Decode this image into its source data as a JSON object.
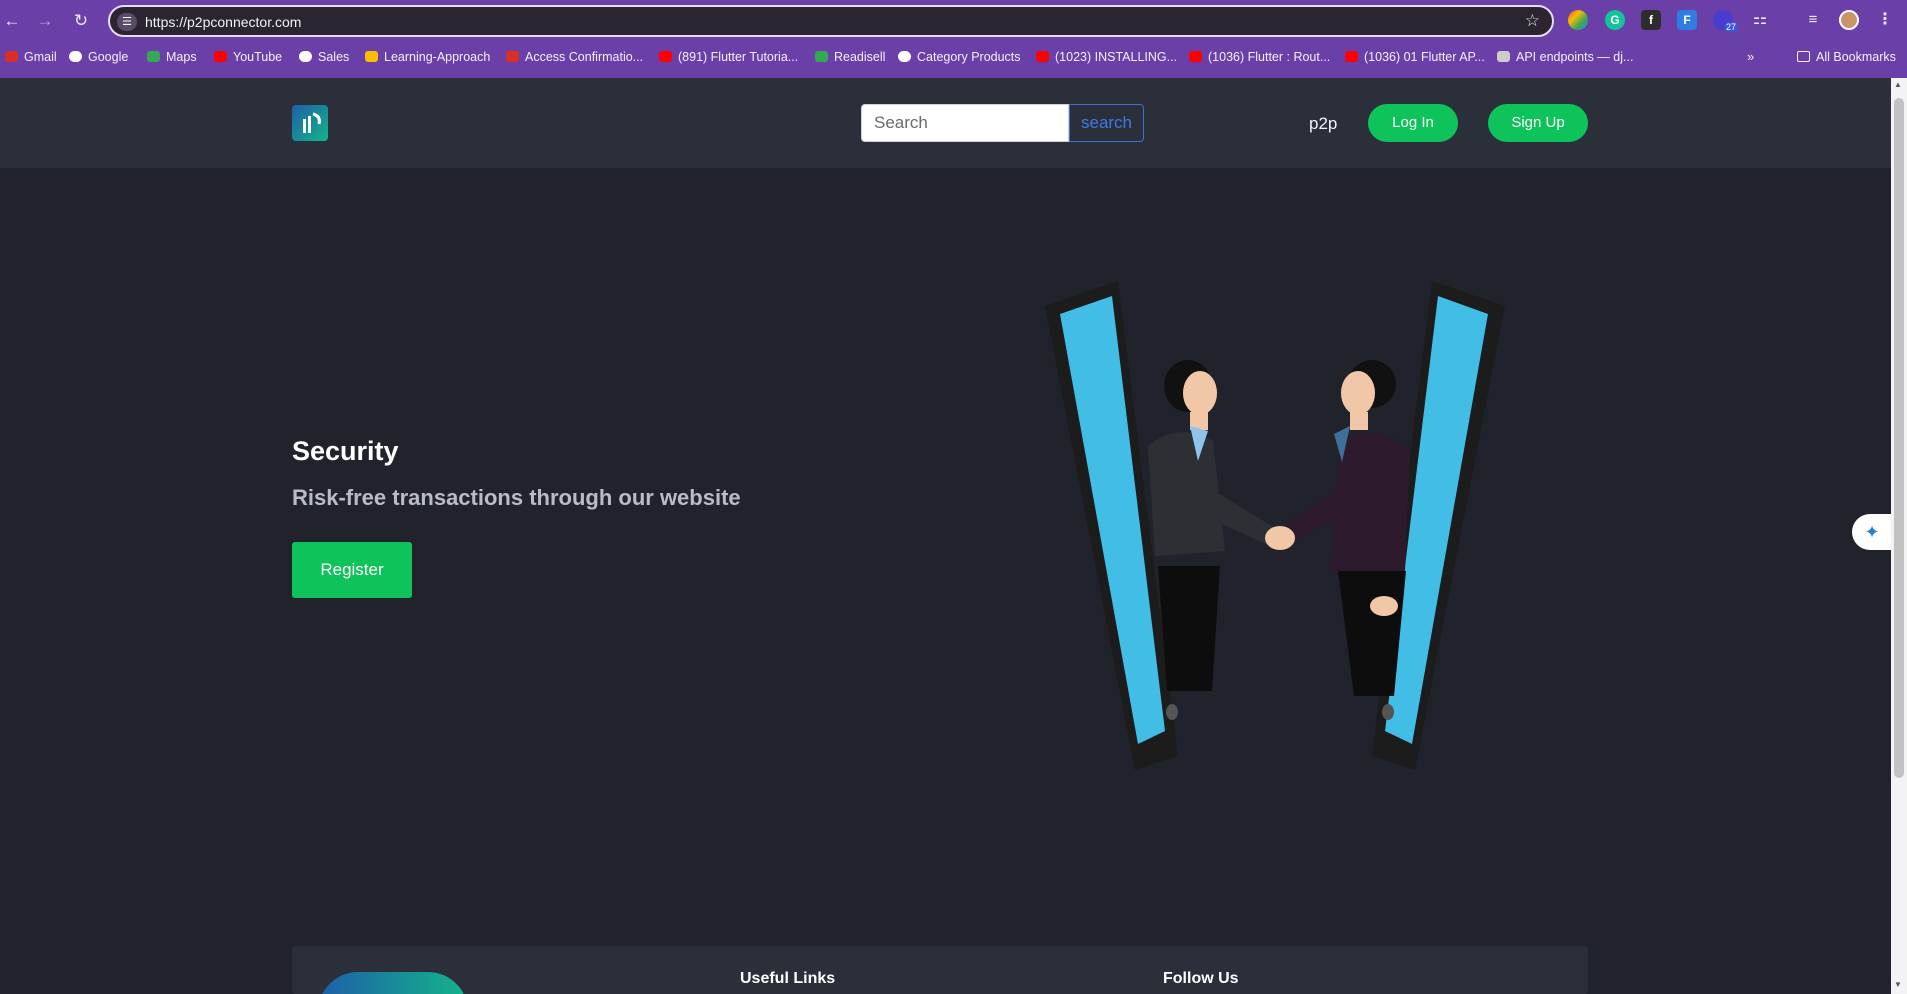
{
  "browser": {
    "url": "https://p2pconnector.com",
    "ext_badge": "27",
    "bookmarks": [
      {
        "label": "Gmail",
        "color": "#d93025"
      },
      {
        "label": "Google",
        "color": "#4285f4"
      },
      {
        "label": "Maps",
        "color": "#34a853"
      },
      {
        "label": "YouTube",
        "color": "#ff0000"
      },
      {
        "label": "Sales",
        "color": "#ffffff"
      },
      {
        "label": "Learning-Approach",
        "color": "#fbbc04"
      },
      {
        "label": "Access Confirmatio...",
        "color": "#d93025"
      },
      {
        "label": "(891) Flutter Tutoria...",
        "color": "#ff0000"
      },
      {
        "label": "Readisell",
        "color": "#34a853"
      },
      {
        "label": "Category Products",
        "color": "#ffffff"
      },
      {
        "label": "(1023) INSTALLING...",
        "color": "#ff0000"
      },
      {
        "label": "(1036) Flutter : Rout...",
        "color": "#ff0000"
      },
      {
        "label": "(1036) 01 Flutter AP...",
        "color": "#ff0000"
      },
      {
        "label": "API endpoints — dj...",
        "color": "#cccccc"
      }
    ],
    "all_bookmarks": "All Bookmarks"
  },
  "header": {
    "search_placeholder": "Search",
    "search_button": "search",
    "brand": "p2p",
    "login": "Log In",
    "signup": "Sign Up"
  },
  "hero": {
    "title": "Security",
    "subtitle": "Risk-free transactions through our website",
    "register": "Register"
  },
  "footer": {
    "useful_links": "Useful Links",
    "follow_us": "Follow Us"
  },
  "colors": {
    "accent_green": "#0dc35a",
    "page_bg": "#20232c",
    "header_bg": "#2b2f3a",
    "browser_purple": "#6b3fa8"
  }
}
